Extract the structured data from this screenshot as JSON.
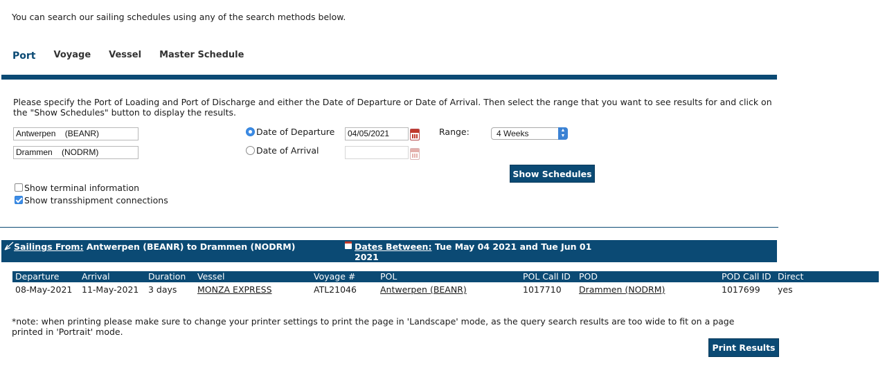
{
  "intro_text": "You can search our sailing schedules using any of the search methods below.",
  "tabs": [
    {
      "label": "Port",
      "active": true
    },
    {
      "label": "Voyage",
      "active": false
    },
    {
      "label": "Vessel",
      "active": false
    },
    {
      "label": "Master Schedule",
      "active": false
    }
  ],
  "colors": {
    "brand": "#0b4a74",
    "accent": "#3d8ce6"
  },
  "form": {
    "instructions": "Please specify the Port of Loading and Port of Discharge and either the Date of Departure or Date of Arrival. Then select the range that you want to see results for and click on the \"Show Schedules\" button to display the results.",
    "port_of_loading": "Antwerpen    (BEANR)",
    "port_of_discharge": "Drammen    (NODRM)",
    "date_of_departure_label": "Date of Departure",
    "date_of_departure_value": "04/05/2021",
    "date_of_departure_selected": true,
    "date_of_arrival_label": "Date of Arrival",
    "date_of_arrival_value": "",
    "range_label": "Range:",
    "range_value": "4 Weeks",
    "show_schedules_label": "Show Schedules",
    "show_terminal_label": "Show terminal information",
    "show_terminal_checked": false,
    "show_transshipment_label": "Show transshipment connections",
    "show_transshipment_checked": true,
    "calendar_icon": "calendar-icon"
  },
  "results": {
    "sailings_from_label": "Sailings From:",
    "sailings_from_value": "Antwerpen (BEANR) to Drammen (NODRM)",
    "dates_between_label": "Dates Between:",
    "dates_between_value": "Tue May 04 2021 and Tue Jun 01",
    "dates_between_value_line2": "2021",
    "columns": [
      "Departure",
      "Arrival",
      "Duration",
      "Vessel",
      "Voyage #",
      "POL",
      "POL Call ID",
      "POD",
      "POD Call ID",
      "Direct"
    ],
    "rows": [
      {
        "departure": "08-May-2021",
        "arrival": "11-May-2021",
        "duration": "3 days",
        "vessel": "MONZA EXPRESS",
        "voyage": "ATL21046",
        "pol": "Antwerpen (BEANR)",
        "pol_call_id": "1017710",
        "pod": "Drammen (NODRM)",
        "pod_call_id": "1017699",
        "direct": "yes"
      }
    ]
  },
  "footer": {
    "note": "*note: when printing please make sure to change your printer settings to print the page in 'Landscape' mode, as the query search results are too wide to fit on a page printed in 'Portrait' mode.",
    "print_label": "Print Results"
  }
}
